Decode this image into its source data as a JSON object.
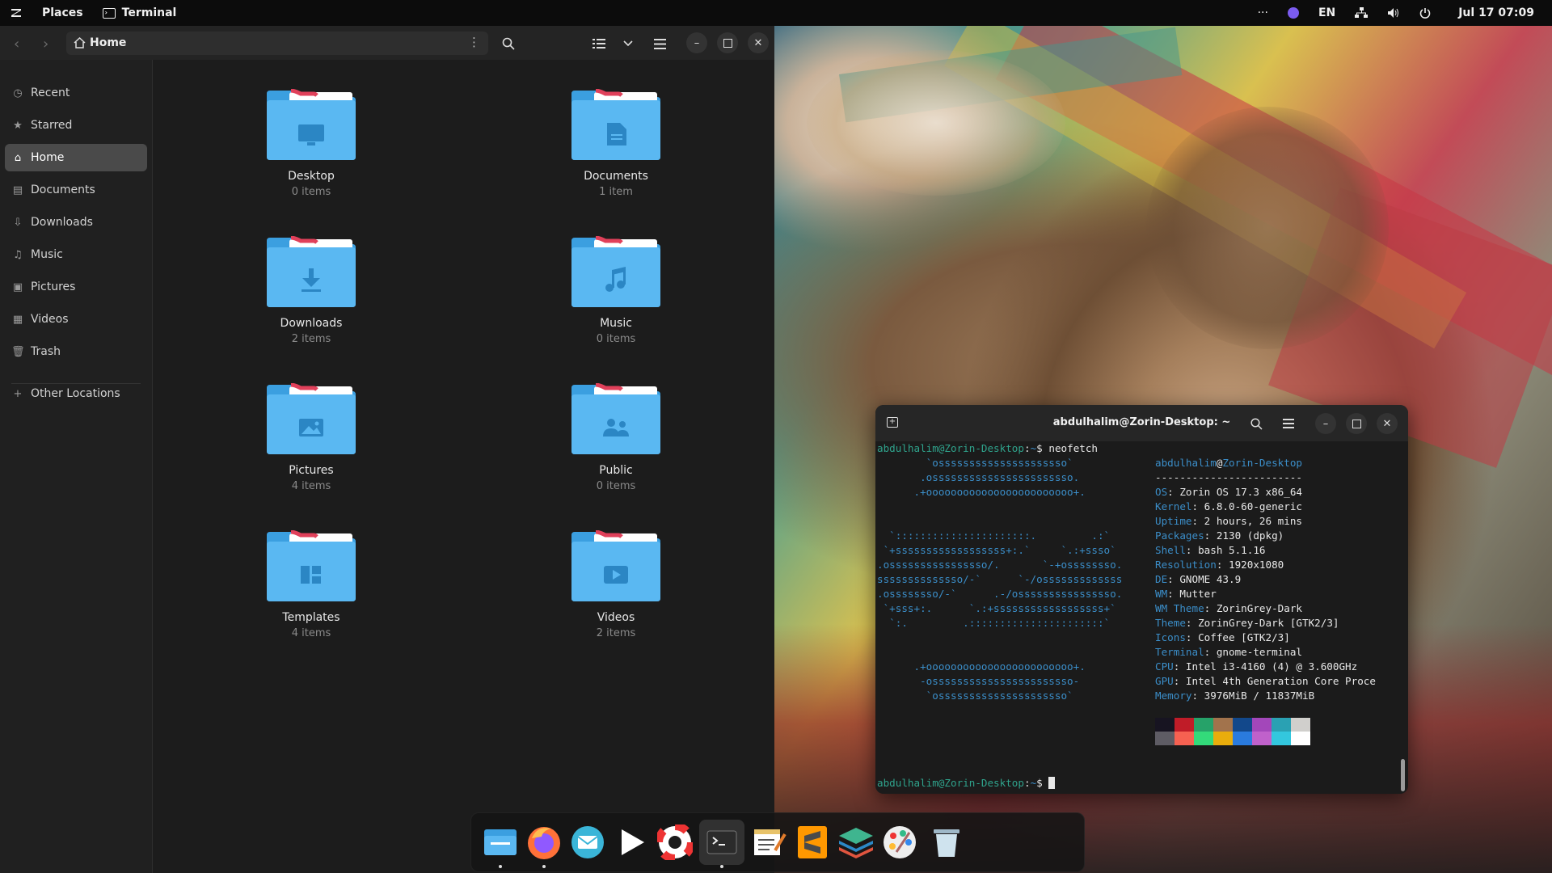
{
  "topbar": {
    "places": "Places",
    "app_name": "Terminal",
    "overflow": "···",
    "keyboard_layout": "EN",
    "datetime": "Jul 17  07:09"
  },
  "files": {
    "path": "Home",
    "sidebar": [
      {
        "label": "Recent",
        "icon": "clock-icon"
      },
      {
        "label": "Starred",
        "icon": "star-icon"
      },
      {
        "label": "Home",
        "icon": "home-icon",
        "active": true
      },
      {
        "label": "Documents",
        "icon": "document-icon"
      },
      {
        "label": "Downloads",
        "icon": "download-icon"
      },
      {
        "label": "Music",
        "icon": "music-icon"
      },
      {
        "label": "Pictures",
        "icon": "pictures-icon"
      },
      {
        "label": "Videos",
        "icon": "videos-icon"
      },
      {
        "label": "Trash",
        "icon": "trash-icon"
      }
    ],
    "other_locations": "Other Locations",
    "folders": [
      {
        "name": "Desktop",
        "count": "0 items",
        "emblem": "monitor"
      },
      {
        "name": "Documents",
        "count": "1 item",
        "emblem": "document"
      },
      {
        "name": "Downloads",
        "count": "2 items",
        "emblem": "download"
      },
      {
        "name": "Music",
        "count": "0 items",
        "emblem": "music"
      },
      {
        "name": "Pictures",
        "count": "4 items",
        "emblem": "image"
      },
      {
        "name": "Public",
        "count": "0 items",
        "emblem": "people"
      },
      {
        "name": "Templates",
        "count": "4 items",
        "emblem": "template"
      },
      {
        "name": "Videos",
        "count": "2 items",
        "emblem": "play"
      }
    ]
  },
  "terminal": {
    "title": "abdulhalim@Zorin-Desktop: ~",
    "prompt_user": "abdulhalim@Zorin-Desktop",
    "prompt_sep": ":",
    "prompt_path": "~",
    "prompt_dollar": "$",
    "command": "neofetch",
    "logo_lines": [
      "        `osssssssssssssssssssso`",
      "       .osssssssssssssssssssssso.",
      "      .+oooooooooooooooooooooooo+.",
      "",
      "",
      "  `::::::::::::::::::::::.         .:`",
      " `+ssssssssssssssssss+:.`     `.:+ssso`",
      ".ossssssssssssssso/.       `-+ossssssso.",
      "ssssssssssssso/-`      `-/osssssssssssss",
      ".ossssssso/-`      .-/ossssssssssssssso.",
      " `+sss+:.      `.:+ssssssssssssssssss+`",
      "  `:.         .::::::::::::::::::::::`",
      "",
      "",
      "      .+oooooooooooooooooooooooo+.",
      "       -osssssssssssssssssssssso-",
      "        `osssssssssssssssssssso`"
    ],
    "user": "abdulhalim",
    "at": "@",
    "host": "Zorin-Desktop",
    "divider": "------------------------",
    "info": [
      {
        "key": "OS",
        "value": "Zorin OS 17.3 x86_64"
      },
      {
        "key": "Kernel",
        "value": "6.8.0-60-generic"
      },
      {
        "key": "Uptime",
        "value": "2 hours, 26 mins"
      },
      {
        "key": "Packages",
        "value": "2130 (dpkg)"
      },
      {
        "key": "Shell",
        "value": "bash 5.1.16"
      },
      {
        "key": "Resolution",
        "value": "1920x1080"
      },
      {
        "key": "DE",
        "value": "GNOME 43.9"
      },
      {
        "key": "WM",
        "value": "Mutter"
      },
      {
        "key": "WM Theme",
        "value": "ZorinGrey-Dark"
      },
      {
        "key": "Theme",
        "value": "ZorinGrey-Dark [GTK2/3]"
      },
      {
        "key": "Icons",
        "value": "Coffee [GTK2/3]"
      },
      {
        "key": "Terminal",
        "value": "gnome-terminal"
      },
      {
        "key": "CPU",
        "value": "Intel i3-4160 (4) @ 3.600GHz"
      },
      {
        "key": "GPU",
        "value": "Intel 4th Generation Core Proce"
      },
      {
        "key": "Memory",
        "value": "3976MiB / 11837MiB"
      }
    ],
    "palette_top": [
      "#171421",
      "#c01c28",
      "#26a269",
      "#a2734c",
      "#12488b",
      "#a347ba",
      "#2aa1b3",
      "#d0cfcc"
    ],
    "palette_bottom": [
      "#5e5c64",
      "#f66151",
      "#33da7a",
      "#e9ad0c",
      "#2a7bde",
      "#c061cb",
      "#33c7de",
      "#ffffff"
    ]
  },
  "dock": [
    {
      "name": "files",
      "active": false,
      "running": true
    },
    {
      "name": "firefox",
      "active": false,
      "running": true
    },
    {
      "name": "mail",
      "active": false,
      "running": false
    },
    {
      "name": "video-player",
      "active": false,
      "running": false
    },
    {
      "name": "help",
      "active": false,
      "running": false
    },
    {
      "name": "terminal",
      "active": true,
      "running": true
    },
    {
      "name": "text-editor",
      "active": false,
      "running": false
    },
    {
      "name": "sublime-text",
      "active": false,
      "running": false
    },
    {
      "name": "layers-app",
      "active": false,
      "running": false
    },
    {
      "name": "paint",
      "active": false,
      "running": false
    },
    {
      "name": "trash",
      "active": false,
      "running": false
    }
  ]
}
